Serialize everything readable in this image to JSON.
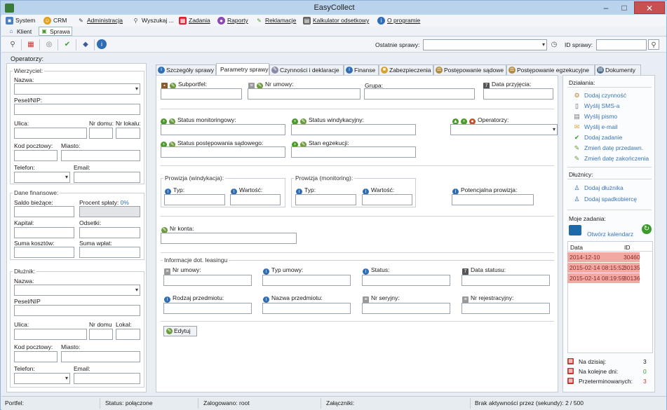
{
  "window": {
    "title": "EasyCollect",
    "buttons": {
      "minimize": "–",
      "maximize": "□",
      "close": "✕"
    }
  },
  "menu": [
    {
      "label": "System",
      "icon": "system-icon",
      "underline": ""
    },
    {
      "label": "CRM",
      "icon": "crm-icon",
      "underline": ""
    },
    {
      "label": "Administracja",
      "icon": "admin-icon",
      "underline": "A"
    },
    {
      "label": "Wyszukaj ...",
      "icon": "search-icon",
      "underline": ""
    },
    {
      "label": "Zadania",
      "icon": "tasks-icon",
      "underline": "Z"
    },
    {
      "label": "Raporty",
      "icon": "reports-icon",
      "underline": "R"
    },
    {
      "label": "Reklamacje",
      "icon": "complaints-icon",
      "underline": "R"
    },
    {
      "label": "Kalkulator odsetkowy",
      "icon": "calculator-icon",
      "underline": "K"
    },
    {
      "label": "O programie",
      "icon": "info-icon",
      "underline": "O"
    }
  ],
  "nav": {
    "klient": "Klient",
    "sprawa": "Sprawa"
  },
  "toolbar": {
    "recent_label": "Ostatnie sprawy:",
    "recent_value": "",
    "id_label": "ID sprawy:",
    "id_value": ""
  },
  "operators_title": "Operatorzy:",
  "left": {
    "creditors": {
      "title": "Wierzyciel:",
      "name": "Nazwa:",
      "pesel": "Pesel/NIP:",
      "street": "Ulica:",
      "house": "Nr domu:",
      "apt": "Nr lokalu:",
      "postal": "Kod pocztowy:",
      "city": "Miasto:",
      "phone": "Telefon:",
      "email": "Email:"
    },
    "financial": {
      "title": "Dane finansowe:",
      "balance": "Saldo bieżące:",
      "percent_label": "Procent spłaty:",
      "percent_value": "0%",
      "capital": "Kapitał:",
      "interest": "Odsetki:",
      "costs": "Suma kosztów:",
      "payments": "Suma wpłat:"
    },
    "debtor": {
      "title": "Dłużnik:",
      "name": "Nazwa:",
      "pesel": "Pesel/NIP",
      "street": "Ulica:",
      "house": "Nr domu",
      "apt": "Lokal:",
      "postal": "Kod pocztowy:",
      "city": "Miasto:",
      "phone": "Telefon:",
      "email": "Email:"
    }
  },
  "tabs": [
    {
      "label": "Szczegóły sprawy",
      "color": "#2f6db5"
    },
    {
      "label": "Parametry sprawy",
      "color": ""
    },
    {
      "label": "Czynności i deklaracje",
      "color": "#5a5a8a"
    },
    {
      "label": "Finanse",
      "color": "#2f6db5"
    },
    {
      "label": "Zabezpieczenia",
      "color": "#d9a32a"
    },
    {
      "label": "Postępowanie sądowe",
      "color": "#b08a3a"
    },
    {
      "label": "Postępowanie egzekucyjne",
      "color": "#b08a3a"
    },
    {
      "label": "Dokumenty",
      "color": "#4a6b8a"
    }
  ],
  "params": {
    "subportfel": "Subportfel:",
    "nr_umowy": "Nr umowy:",
    "grupa": "Grupa:",
    "data_przyjecia": "Data przyjęcia:",
    "status_monitoringowy": "Status monitoringowy:",
    "status_windykacyjny": "Status windykacyjny:",
    "operatorzy": "Operatorzy:",
    "status_sadowy": "Status postępowania sądowego:",
    "stan_egzekucji": "Stan egzekucji:",
    "prowizja_windykacja": "Prowizja (windykacja):",
    "prowizja_monitoring": "Prowizja (monitoring):",
    "typ": "Typ:",
    "wartosc": "Wartość:",
    "potencjalna_prowizja": "Potencjalna prowizja:",
    "nr_konta": "Nr konta:",
    "leasing_title": "Informacje dot. leasingu",
    "l_nr_umowy": "Nr umowy:",
    "l_typ_umowy": "Typ umowy:",
    "l_status": "Status:",
    "l_data_statusu": "Data statusu:",
    "l_rodzaj": "Rodzaj przedmiotu:",
    "l_nazwa": "Nazwa przedmiotu:",
    "l_nr_seryjny": "Nr seryjny:",
    "l_nr_rej": "Nr rejestracyjny:",
    "edit_button": "Edytuj"
  },
  "actions": {
    "title": "Działania:",
    "items": [
      "Dodaj czynność",
      "Wyślij SMS-a",
      "Wyślij pismo",
      "Wyślij e-mail",
      "Dodaj zadanie",
      "Zmień datę przedawn.",
      "Zmień datę zakończenia"
    ]
  },
  "debtors": {
    "title": "Dłużnicy:",
    "items": [
      "Dodaj dłużnika",
      "Dodaj spadkobiercę"
    ]
  },
  "tasks": {
    "title": "Moje zadania:",
    "calendar": "Otwórz kalendarz",
    "col_date": "Data",
    "col_id": "ID",
    "rows": [
      {
        "date": "2014-12-10",
        "id": "30460"
      },
      {
        "date": "2015-02-14 08:15:52",
        "id": "30135"
      },
      {
        "date": "2015-02-14 08:19:59",
        "id": "30136"
      }
    ],
    "today_label": "Na dzisiaj:",
    "today_value": "3",
    "next_label": "Na kolejne dni:",
    "next_value": "0",
    "overdue_label": "Przeterminowanych:",
    "overdue_value": "3"
  },
  "status": {
    "portfel": "Portfel:",
    "status": "Status: połączone",
    "user": "Zalogowano: root",
    "attachments": "Załączniki:",
    "inactivity": "Brak aktywności przez (sekundy): 2 / 500"
  }
}
